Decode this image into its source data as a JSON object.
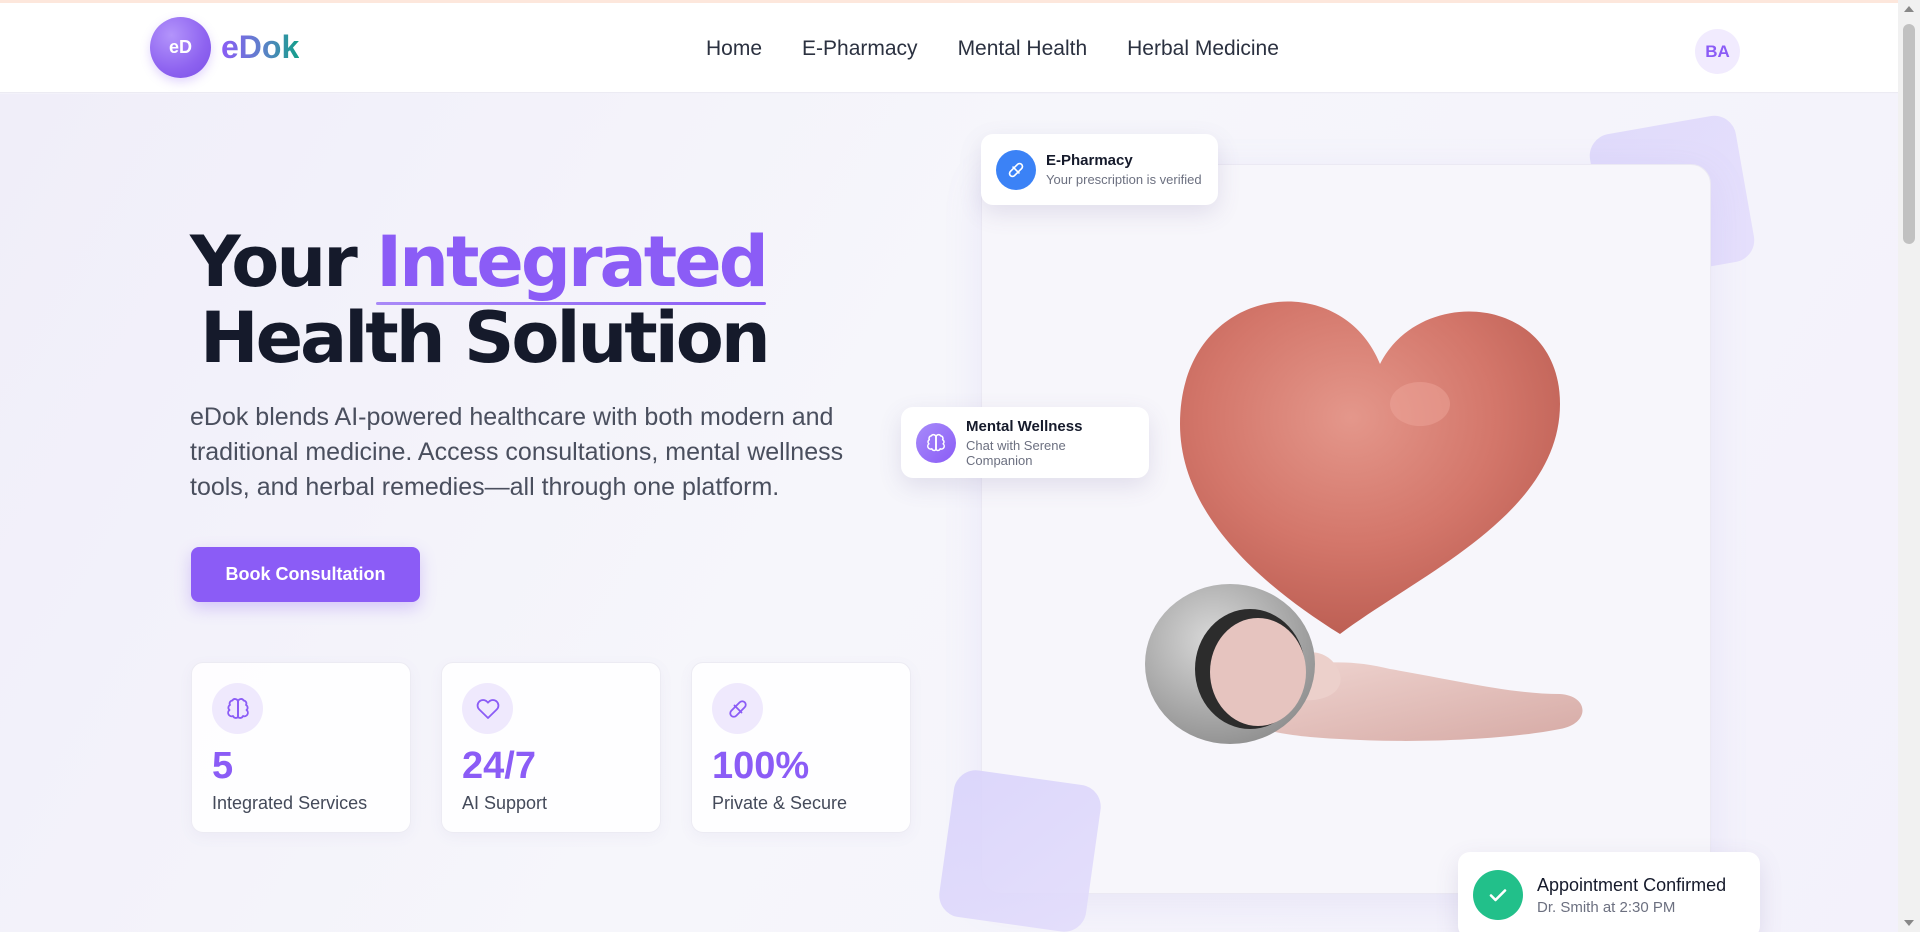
{
  "brand": {
    "badge": "eD",
    "name": "eDok"
  },
  "nav": {
    "items": [
      {
        "label": "Home"
      },
      {
        "label": "E-Pharmacy"
      },
      {
        "label": "Mental Health"
      },
      {
        "label": "Herbal Medicine"
      }
    ]
  },
  "user": {
    "initials": "BA"
  },
  "hero": {
    "title_prefix": "Your",
    "title_accent": "Integrated",
    "title_line2": "Health Solution",
    "description": "eDok blends AI-powered healthcare with both modern and traditional medicine. Access consultations, mental wellness tools, and herbal remedies—all through one platform.",
    "cta_label": "Book Consultation"
  },
  "stats": [
    {
      "value": "5",
      "label": "Integrated Services",
      "icon": "brain-icon"
    },
    {
      "value": "24/7",
      "label": "AI Support",
      "icon": "heart-icon"
    },
    {
      "value": "100%",
      "label": "Private & Secure",
      "icon": "pill-icon"
    }
  ],
  "floating_cards": {
    "pharmacy": {
      "title": "E-Pharmacy",
      "subtitle": "Your prescription is verified",
      "icon": "pill-icon"
    },
    "wellness": {
      "title": "Mental Wellness",
      "subtitle": "Chat with Serene Companion",
      "icon": "brain-icon"
    },
    "appointment": {
      "title": "Appointment Confirmed",
      "subtitle": "Dr. Smith at 2:30 PM",
      "icon": "check-icon"
    }
  },
  "colors": {
    "accent": "#8b5cf6",
    "text_dark": "#151a2b",
    "success": "#22c08a",
    "pharmacy_blue": "#3b82f6"
  }
}
